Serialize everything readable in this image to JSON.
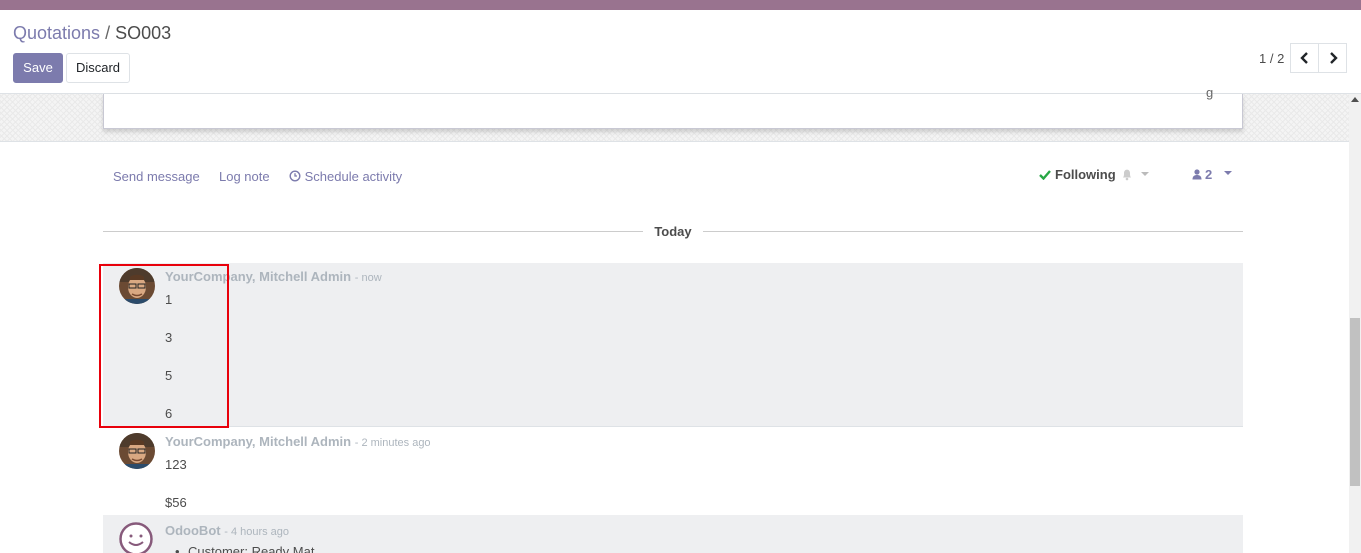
{
  "breadcrumb": {
    "parent": "Quotations",
    "separator": "/",
    "current": "SO003"
  },
  "buttons": {
    "save": "Save",
    "discard": "Discard"
  },
  "pager": {
    "value": "1 / 2"
  },
  "sheet": {
    "fragment": "g"
  },
  "chatter": {
    "send_message": "Send message",
    "log_note": "Log note",
    "schedule_activity": "Schedule activity",
    "following": "Following",
    "followers_count": "2"
  },
  "date_separator": "Today",
  "messages": [
    {
      "author": "YourCompany, Mitchell Admin",
      "date": "- now",
      "lines": [
        "1",
        "3",
        "5",
        "6"
      ]
    },
    {
      "author": "YourCompany, Mitchell Admin",
      "date": "- 2 minutes ago",
      "lines": [
        "123",
        "$56"
      ]
    },
    {
      "author": "OdooBot",
      "date": "- 4 hours ago",
      "bullets": [
        "Customer: Ready Mat"
      ]
    }
  ],
  "colors": {
    "brand": "#875a7b",
    "link": "#7c7bad",
    "check": "#28a745",
    "highlight": "#e8000b"
  }
}
